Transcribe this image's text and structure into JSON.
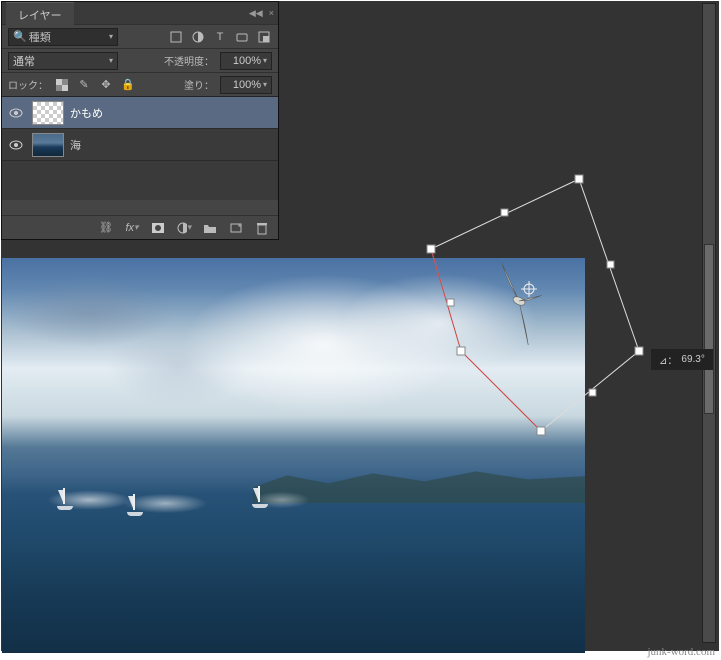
{
  "panel": {
    "title": "レイヤー",
    "filter_label": "種類",
    "blend_mode": "通常",
    "opacity_label": "不透明度：",
    "opacity_value": "100%",
    "lock_label": "ロック：",
    "fill_label": "塗り：",
    "fill_value": "100%",
    "layers": [
      {
        "name": "かもめ",
        "visible": true,
        "selected": true,
        "thumb": "checker"
      },
      {
        "name": "海",
        "visible": true,
        "selected": false,
        "thumb": "sea"
      }
    ]
  },
  "transform": {
    "angle_label": "⊿：",
    "angle_value": "69.3°"
  },
  "watermark": "junk-word.com"
}
